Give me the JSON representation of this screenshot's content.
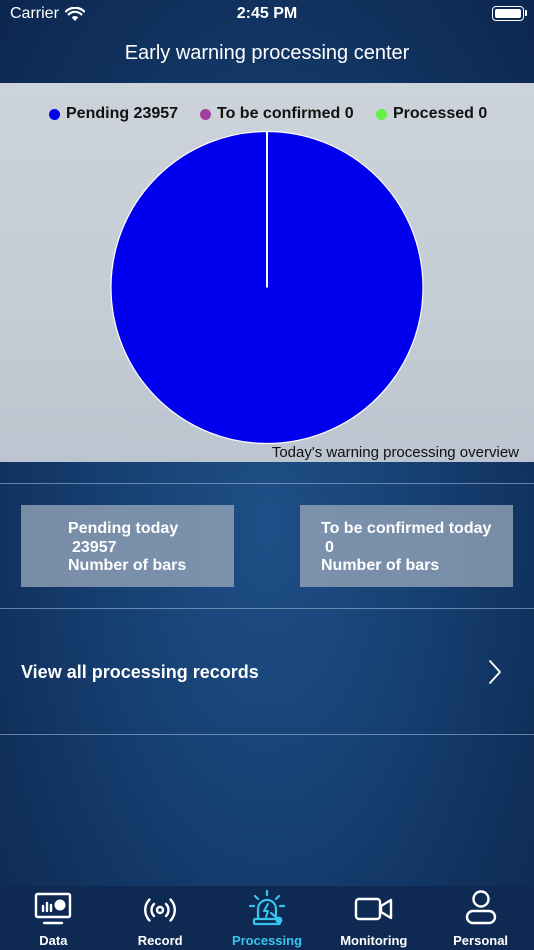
{
  "status_bar": {
    "carrier": "Carrier",
    "time": "2:45 PM"
  },
  "nav": {
    "title": "Early warning processing center"
  },
  "chart_data": {
    "type": "pie",
    "slices": [
      {
        "label": "Pending",
        "value": 23957,
        "color": "#0000ee"
      },
      {
        "label": "To be confirmed",
        "value": 0,
        "color": "#a040a0"
      },
      {
        "label": "Processed",
        "value": 0,
        "color": "#66ee44"
      }
    ],
    "legend": [
      "Pending 23957",
      "To be confirmed 0",
      "Processed 0"
    ],
    "legend_position": "top",
    "caption": "Today's warning processing overview"
  },
  "stats": [
    {
      "title": "Pending today",
      "value": "23957",
      "unit": "Number of bars"
    },
    {
      "title": "To be confirmed today",
      "value": "0",
      "unit": "Number of bars"
    }
  ],
  "records": {
    "label": "View all processing records"
  },
  "tabs": [
    {
      "label": "Data",
      "icon": "monitor-chart-icon",
      "active": false
    },
    {
      "label": "Record",
      "icon": "broadcast-icon",
      "active": false
    },
    {
      "label": "Processing",
      "icon": "alarm-light-icon",
      "active": true
    },
    {
      "label": "Monitoring",
      "icon": "video-camera-icon",
      "active": false
    },
    {
      "label": "Personal",
      "icon": "person-icon",
      "active": false
    }
  ],
  "colors": {
    "active_tab": "#37c5f0",
    "inactive_tab": "#ffffff"
  }
}
